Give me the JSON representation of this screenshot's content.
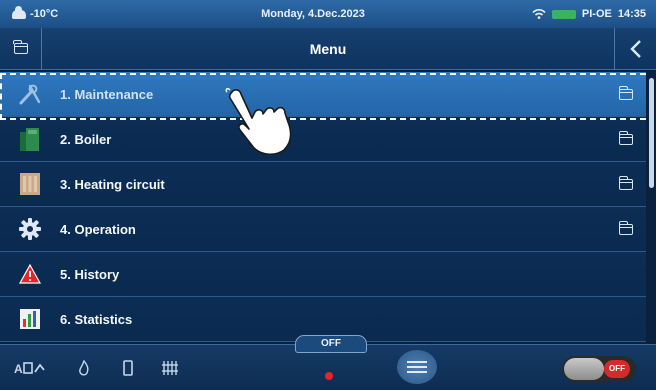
{
  "status": {
    "temperature": "-10°C",
    "date": "Monday, 4.Dec.2023",
    "device": "PI-OE",
    "time": "14:35"
  },
  "header": {
    "title": "Menu",
    "back_icon": "chevron-left-icon",
    "folder_icon": "folder-icon"
  },
  "menu": {
    "items": [
      {
        "label": "1. Maintenance",
        "icon": "tools-icon",
        "has_folder": true,
        "selected": true
      },
      {
        "label": "2. Boiler",
        "icon": "boiler-icon",
        "has_folder": true,
        "selected": false
      },
      {
        "label": "3. Heating circuit",
        "icon": "heating-circuit-icon",
        "has_folder": true,
        "selected": false
      },
      {
        "label": "4. Operation",
        "icon": "gear-icon",
        "has_folder": true,
        "selected": false
      },
      {
        "label": "5. History",
        "icon": "warning-icon",
        "has_folder": false,
        "selected": false
      },
      {
        "label": "6. Statistics",
        "icon": "bar-chart-icon",
        "has_folder": false,
        "selected": false
      }
    ]
  },
  "bottom": {
    "off_label": "OFF",
    "toggle_label": "OFF"
  },
  "colors": {
    "selected_row": "#2f78c0",
    "row_bg": "#0b2c54",
    "warning_red": "#e8232a"
  }
}
